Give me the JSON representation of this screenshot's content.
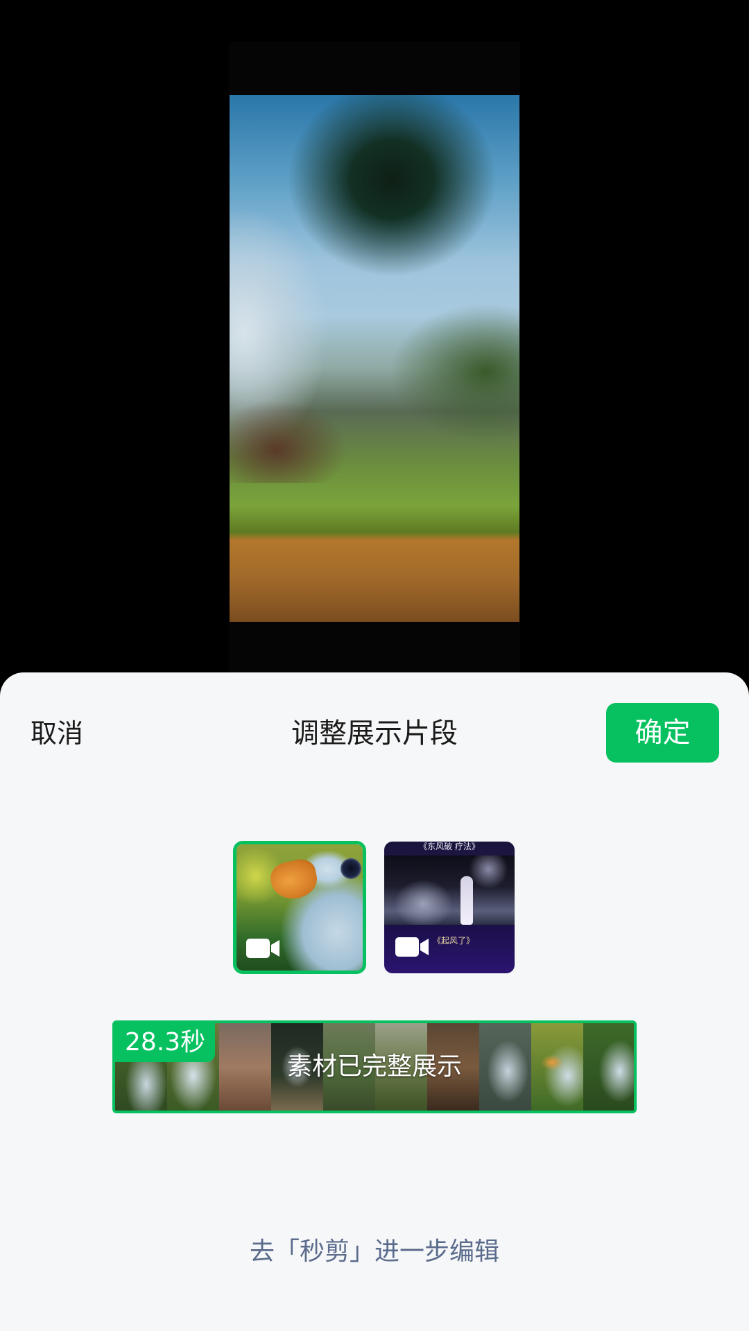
{
  "header": {
    "cancel_label": "取消",
    "title": "调整展示片段",
    "confirm_label": "确定"
  },
  "thumbnails": [
    {
      "id": "duck-video",
      "type": "video",
      "selected": true
    },
    {
      "id": "concert-video",
      "type": "video",
      "selected": false,
      "overlay_title": "《东风破 疗法》",
      "overlay_caption": "《起风了》"
    }
  ],
  "timeline": {
    "duration_badge": "28.3秒",
    "status_text": "素材已完整展示"
  },
  "footer": {
    "edit_link": "去「秒剪」进一步编辑"
  },
  "colors": {
    "accent": "#07c160",
    "link": "#5b6b8c",
    "sheet_background": "#f6f7f8"
  },
  "icons": {
    "thumbnail_type": "video-camera-icon"
  }
}
